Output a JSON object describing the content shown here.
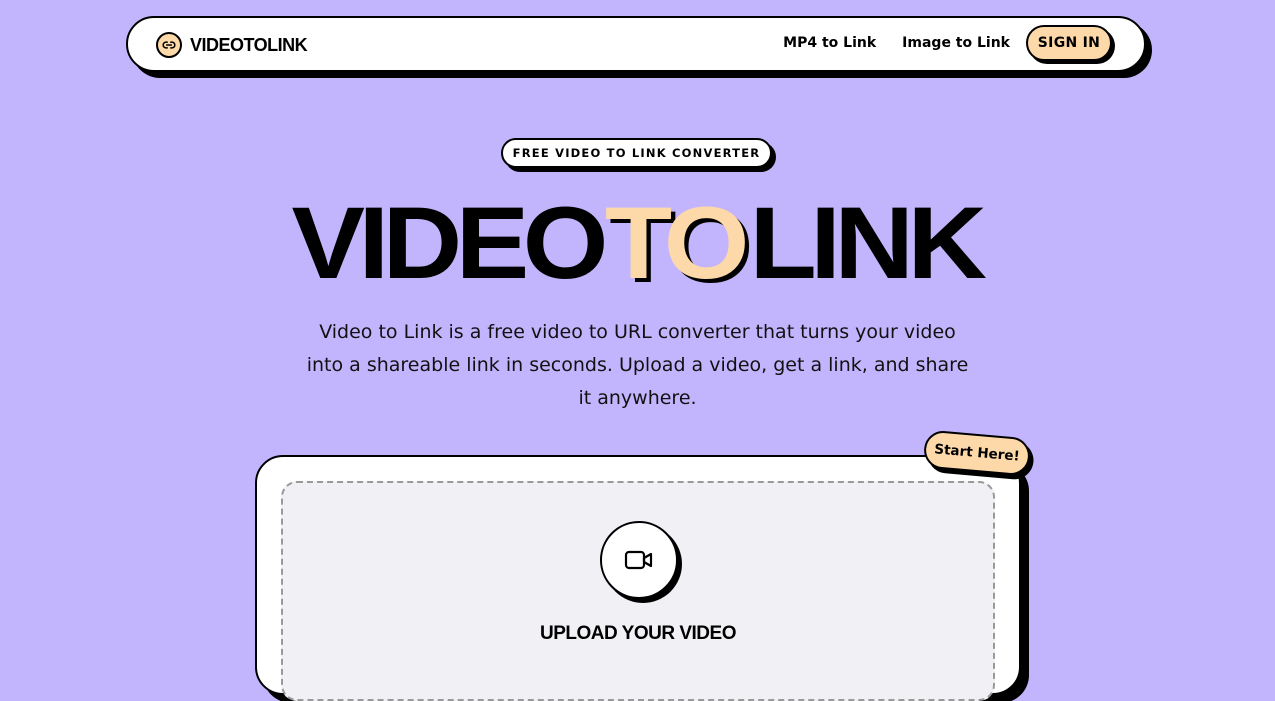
{
  "header": {
    "logo_text": "VIDEOTOLINK",
    "logo_icon": "link-icon",
    "nav": [
      {
        "label": "MP4 to Link"
      },
      {
        "label": "Image to Link"
      }
    ],
    "signin_label": "SIGN IN"
  },
  "hero": {
    "badge": "FREE VIDEO TO LINK CONVERTER",
    "title_part1": "VIDEO",
    "title_highlight": "TO",
    "title_part2": "LINK",
    "description": "Video to Link is a free video to URL converter that turns your video into a shareable link in seconds. Upload a video, get a link, and share it anywhere."
  },
  "upload": {
    "start_label": "Start Here!",
    "icon": "video-camera-icon",
    "title": "UPLOAD YOUR VIDEO"
  },
  "colors": {
    "background": "#c3b5fd",
    "accent": "#fdd9a9",
    "surface": "#ffffff",
    "dropzone": "#f1f0f5",
    "ink": "#000000"
  }
}
